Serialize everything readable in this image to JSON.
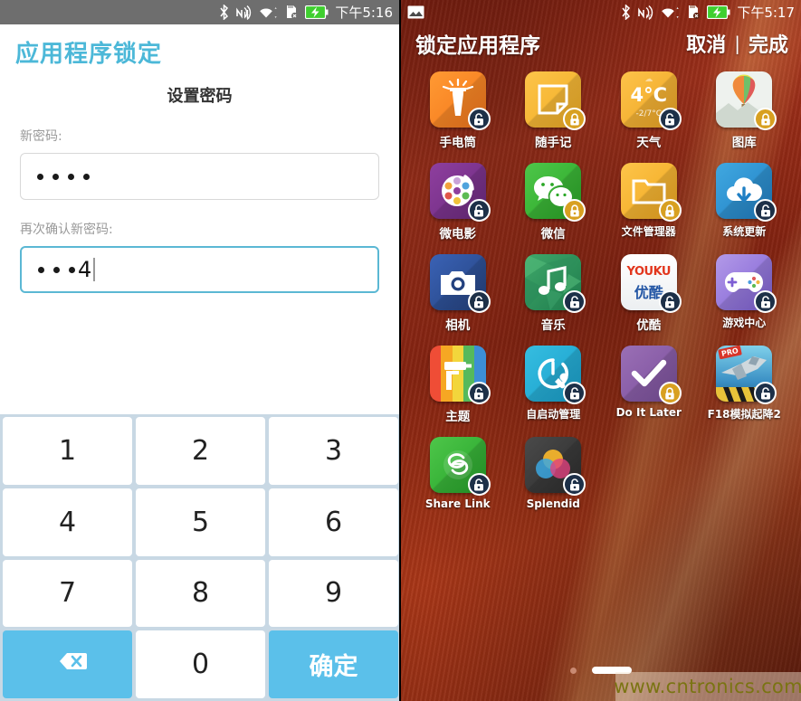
{
  "left_phone": {
    "status_bar": {
      "time": "下午5:16",
      "icons": [
        "bluetooth-icon",
        "nfc-icon",
        "wifi-icon",
        "sdcard-error-icon",
        "battery-charging-icon"
      ]
    },
    "app_title": "应用程序锁定",
    "section_title": "设置密码",
    "fields": [
      {
        "label": "新密码:",
        "value": "••••",
        "masked_count": 4,
        "visible_char": "",
        "focused": false
      },
      {
        "label": "再次确认新密码:",
        "value": "•••4",
        "masked_count": 3,
        "visible_char": "4",
        "focused": true
      }
    ],
    "keypad": {
      "keys": [
        {
          "label": "1",
          "name": "key-1",
          "style": "plain"
        },
        {
          "label": "2",
          "name": "key-2",
          "style": "plain"
        },
        {
          "label": "3",
          "name": "key-3",
          "style": "plain"
        },
        {
          "label": "4",
          "name": "key-4",
          "style": "plain"
        },
        {
          "label": "5",
          "name": "key-5",
          "style": "plain"
        },
        {
          "label": "6",
          "name": "key-6",
          "style": "plain"
        },
        {
          "label": "7",
          "name": "key-7",
          "style": "plain"
        },
        {
          "label": "8",
          "name": "key-8",
          "style": "plain"
        },
        {
          "label": "9",
          "name": "key-9",
          "style": "plain"
        },
        {
          "label": "",
          "name": "key-backspace",
          "style": "accent-icon"
        },
        {
          "label": "0",
          "name": "key-0",
          "style": "plain"
        },
        {
          "label": "确定",
          "name": "key-confirm",
          "style": "accent"
        }
      ]
    },
    "colors": {
      "accent": "#5bc0ea",
      "title": "#4cb8d8",
      "statusbar": "#6e6e6e",
      "keypad_bg": "#c8d8e4"
    }
  },
  "right_phone": {
    "status_bar": {
      "time": "下午5:17",
      "icons": [
        "screenshot-icon",
        "bluetooth-icon",
        "nfc-icon",
        "wifi-icon",
        "sdcard-error-icon",
        "battery-charging-icon"
      ]
    },
    "title": "锁定应用程序",
    "actions": {
      "cancel": "取消",
      "separator": "|",
      "done": "完成"
    },
    "apps": [
      {
        "label": "手电筒",
        "locked": false,
        "icon": "flashlight-icon"
      },
      {
        "label": "随手记",
        "locked": true,
        "icon": "notes-icon"
      },
      {
        "label": "天气",
        "locked": false,
        "icon": "weather-icon",
        "temp": "4°C",
        "temp_range": "-2/7°C"
      },
      {
        "label": "图库",
        "locked": true,
        "icon": "gallery-icon"
      },
      {
        "label": "微电影",
        "locked": false,
        "icon": "microfilm-icon"
      },
      {
        "label": "微信",
        "locked": true,
        "icon": "wechat-icon"
      },
      {
        "label": "文件管理器",
        "locked": true,
        "icon": "file-manager-icon"
      },
      {
        "label": "系统更新",
        "locked": false,
        "icon": "system-update-icon"
      },
      {
        "label": "相机",
        "locked": false,
        "icon": "camera-icon"
      },
      {
        "label": "音乐",
        "locked": false,
        "icon": "music-icon"
      },
      {
        "label": "优酷",
        "locked": false,
        "icon": "youku-icon",
        "brand_top": "YOUKU",
        "brand_bottom": "优酷"
      },
      {
        "label": "游戏中心",
        "locked": false,
        "icon": "game-center-icon"
      },
      {
        "label": "主题",
        "locked": false,
        "icon": "theme-icon"
      },
      {
        "label": "自启动管理",
        "locked": false,
        "icon": "autostart-manager-icon"
      },
      {
        "label": "Do It Later",
        "locked": true,
        "icon": "do-it-later-icon"
      },
      {
        "label": "F18模拟起降2",
        "locked": false,
        "icon": "f18-game-icon",
        "badge_text": "PRO"
      },
      {
        "label": "Share Link",
        "locked": false,
        "icon": "share-link-icon"
      },
      {
        "label": "Splendid",
        "locked": false,
        "icon": "splendid-icon"
      }
    ],
    "pager": {
      "dots": 1,
      "active_pill": true
    },
    "watermark": "www.cntronics.com",
    "colors": {
      "locked_badge": "#d8a021",
      "unlocked_badge": "#1d3048",
      "wallpaper": "#8e2b16"
    }
  }
}
